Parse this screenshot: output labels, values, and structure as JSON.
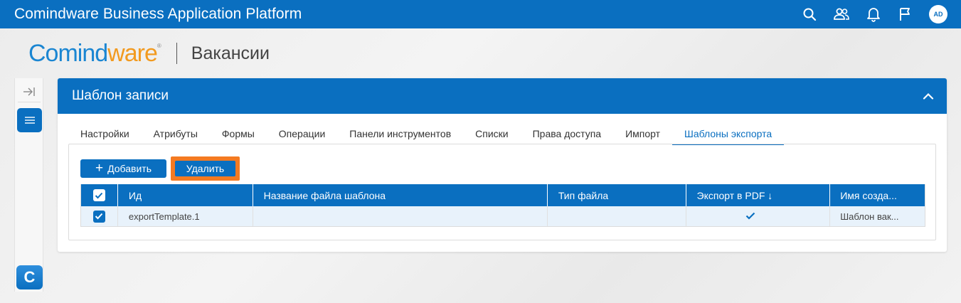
{
  "app": {
    "title": "Comindware Business Application Platform",
    "avatar_initials": "AD"
  },
  "logo": {
    "part1": "Comind",
    "part2": "ware",
    "reg": "®"
  },
  "page": {
    "title": "Вакансии"
  },
  "rail": {
    "logo_letter": "C"
  },
  "card": {
    "title": "Шаблон записи",
    "tabs": [
      {
        "label": "Настройки"
      },
      {
        "label": "Атрибуты"
      },
      {
        "label": "Формы"
      },
      {
        "label": "Операции"
      },
      {
        "label": "Панели инструментов"
      },
      {
        "label": "Списки"
      },
      {
        "label": "Права доступа"
      },
      {
        "label": "Импорт"
      },
      {
        "label": "Шаблоны экспорта",
        "active": true
      }
    ]
  },
  "toolbar": {
    "add_label": "Добавить",
    "delete_label": "Удалить"
  },
  "table": {
    "columns": [
      "Ид",
      "Название файла шаблона",
      "Тип файла",
      "Экспорт в PDF ↓",
      "Имя созда..."
    ],
    "rows": [
      {
        "checked": true,
        "id": "exportTemplate.1",
        "file_name": "",
        "file_type": "",
        "export_pdf": true,
        "creator": "Шаблон вак..."
      }
    ]
  },
  "colors": {
    "primary": "#0a6fc0",
    "highlight": "#f47a21",
    "row_selected": "#e8f2fb"
  }
}
